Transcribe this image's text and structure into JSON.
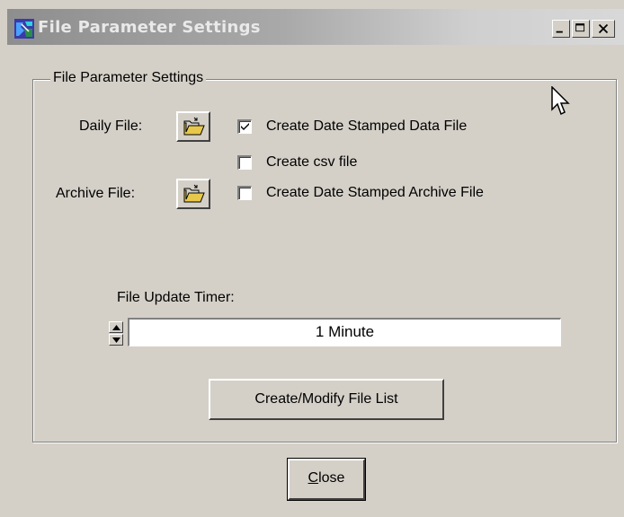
{
  "window": {
    "title": "File Parameter Settings",
    "controls": [
      "minimize-icon",
      "maximize-icon",
      "close-icon"
    ]
  },
  "group": {
    "legend": "File Parameter Settings"
  },
  "daily_file": {
    "label": "Daily File:",
    "browse_icon": "open-folder-icon",
    "checkbox_label": "Create Date Stamped Data File",
    "checked": true
  },
  "csv": {
    "checkbox_label": "Create csv file",
    "checked": false
  },
  "archive_file": {
    "label": "Archive File:",
    "browse_icon": "open-folder-icon",
    "checkbox_label": "Create Date Stamped Archive File",
    "checked": false
  },
  "timer": {
    "label": "File Update Timer:",
    "value": "1 Minute"
  },
  "buttons": {
    "create_modify": "Create/Modify File List",
    "close_mnemonic": "C",
    "close_rest": "lose"
  },
  "colors": {
    "face": "#d4d0c8",
    "title_gradient_start": "#8e8e8e",
    "title_gradient_end": "#d8d8d8",
    "folder_yellow": "#e8c84a"
  }
}
